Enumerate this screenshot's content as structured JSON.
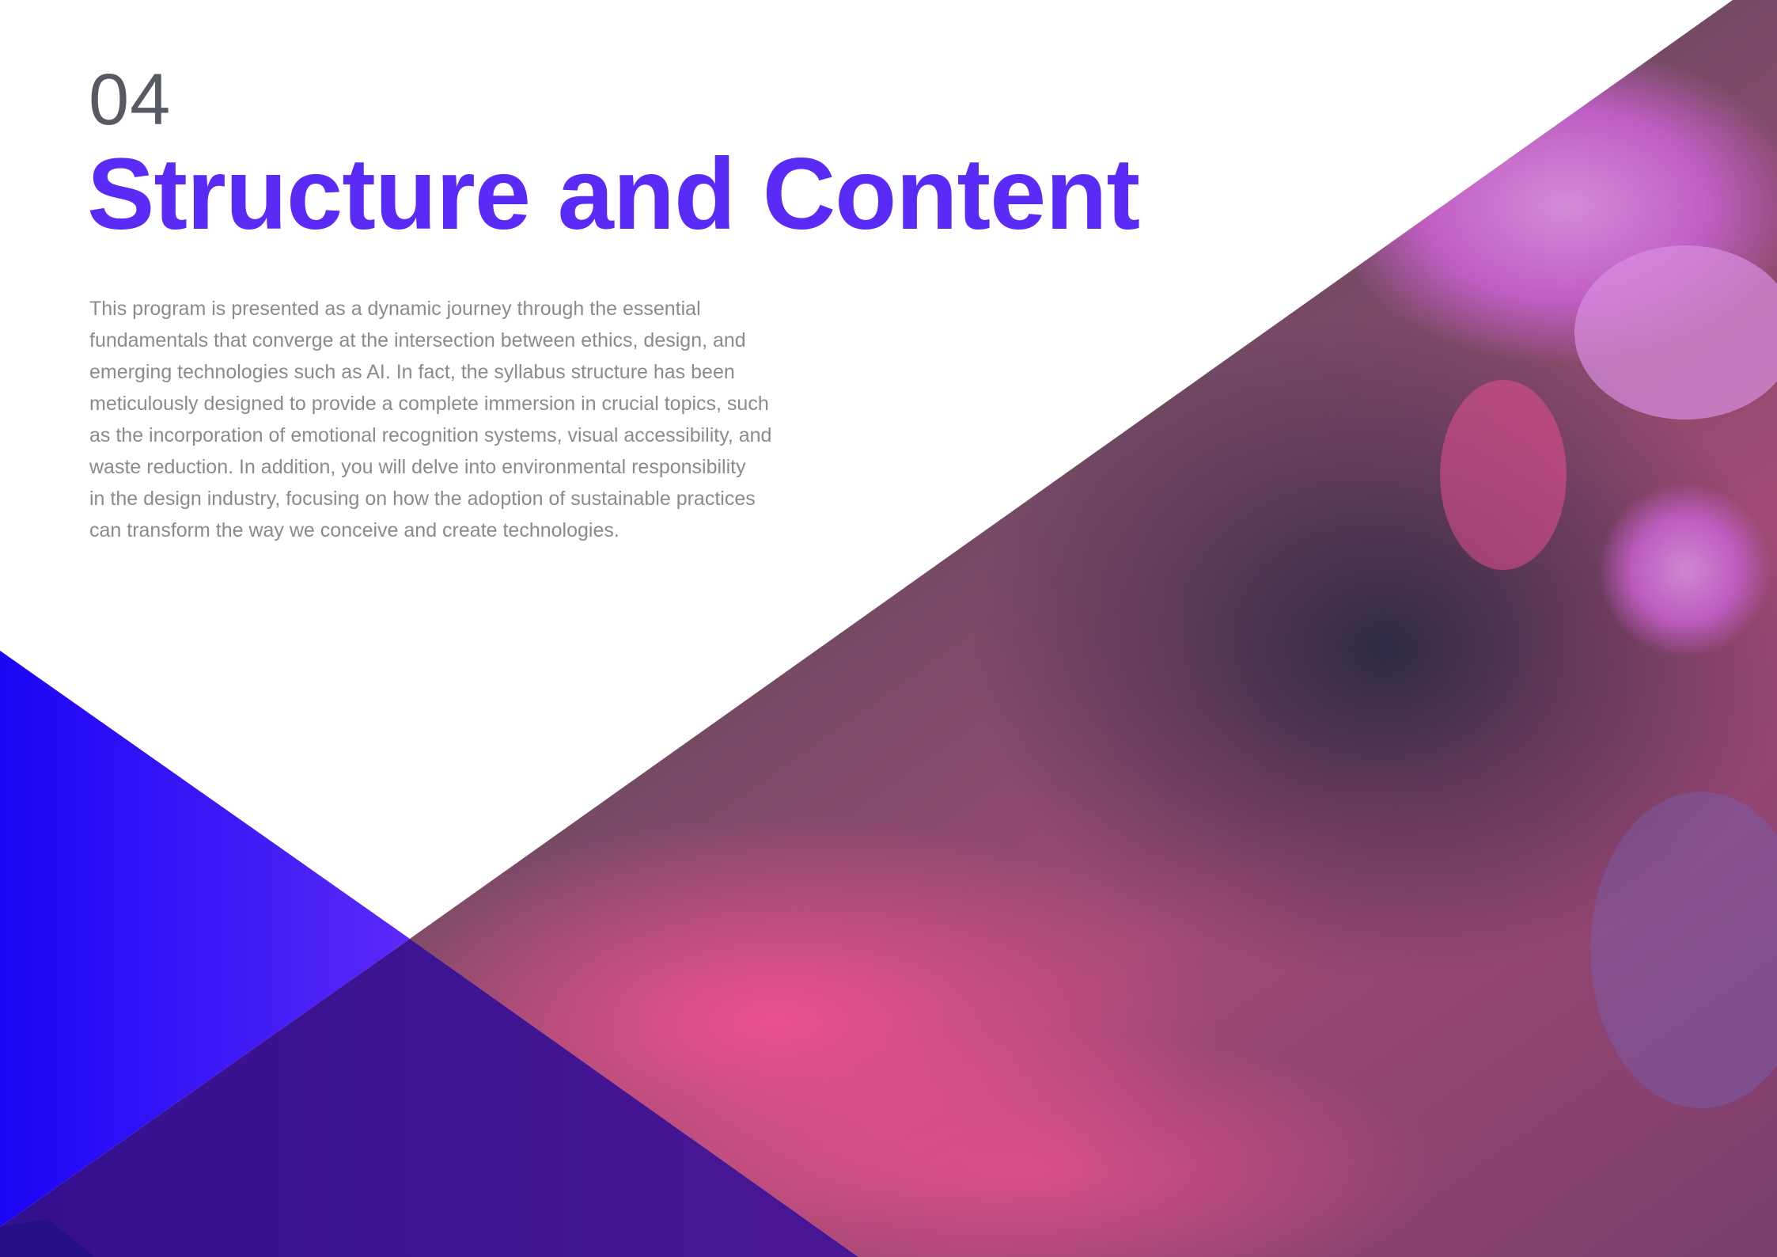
{
  "section": {
    "number": "04",
    "title": "Structure and Content"
  },
  "body": {
    "lines": [
      "This program is presented as a dynamic journey through the essential",
      "fundamentals that converge at the intersection between ethics, design, and",
      "emerging technologies such as AI. In fact, the syllabus structure has been",
      "meticulously designed to provide a complete immersion in crucial topics, such",
      "as the incorporation of emotional recognition systems, visual accessibility, and",
      "waste reduction. In addition, you will delve into environmental responsibility",
      "in the design industry, focusing on how the adoption of sustainable practices",
      "can transform the way we conceive and create technologies."
    ]
  },
  "colors": {
    "title": "#5a2af7",
    "number": "#575a63",
    "body_text": "#8a8a8f",
    "accent_blue": "#1a05f5",
    "accent_violet": "#5a2af7",
    "photo_magenta": "#e84a8e",
    "photo_dark": "#4b4453"
  },
  "decoration": {
    "photo_description_icon": "hand-holding-phone-photo"
  }
}
